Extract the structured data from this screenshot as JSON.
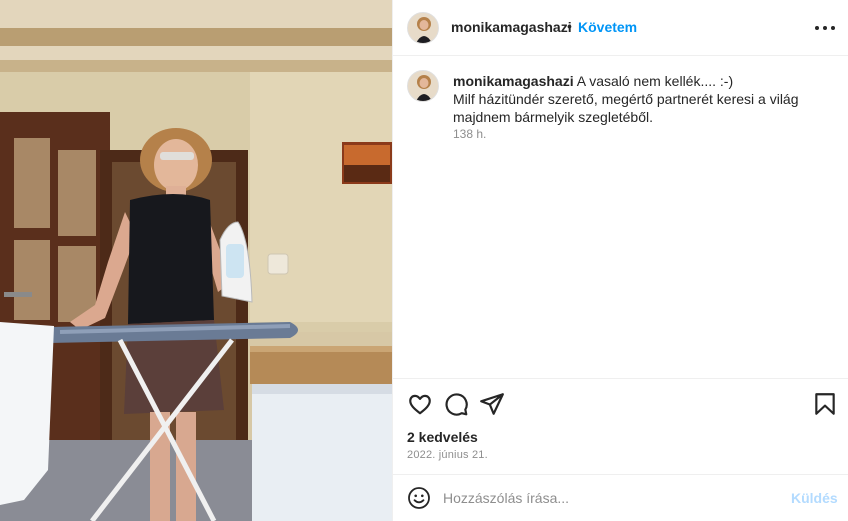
{
  "post": {
    "username": "monikamagashazi",
    "separator": "•",
    "follow_label": "Követem",
    "caption_lines": [
      "A vasaló nem kellék.... :-)",
      "Milf házitündér szerető, megértő partnerét keresi a világ majdnem bármelyik szegletéből."
    ],
    "time_ago": "138 h.",
    "likes": "2 kedvelés",
    "date": "2022. június 21."
  },
  "comment_box": {
    "placeholder": "Hozzászólás írása...",
    "send_label": "Küldés"
  },
  "icons": {
    "more": "more-options-icon",
    "like": "heart-icon",
    "comment": "comment-bubble-icon",
    "share": "paper-plane-icon",
    "save": "bookmark-icon",
    "emoji": "emoji-smile-icon"
  },
  "colors": {
    "accent": "#0095f6",
    "send_disabled": "#b3dbff",
    "text": "#262626",
    "muted": "#8e8e8e",
    "divider": "#efefef"
  }
}
